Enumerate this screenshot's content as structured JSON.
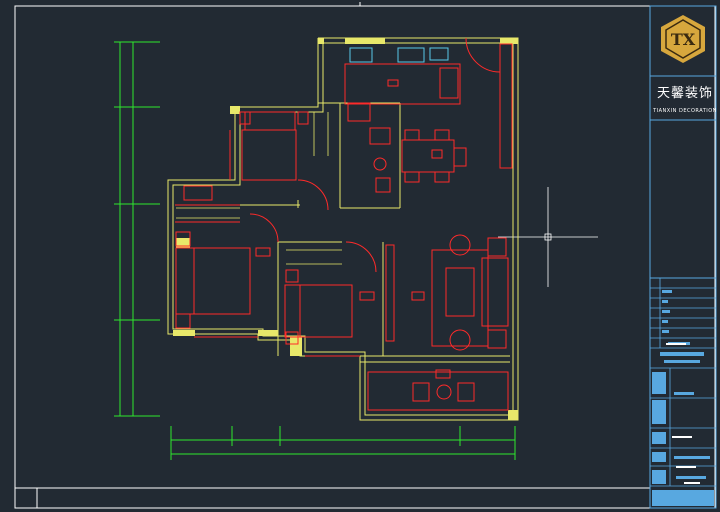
{
  "title_block": {
    "logo_monogram": "TX",
    "company_cn": "天馨装饰",
    "company_en": "TIANXIN DECORATION"
  },
  "colors": {
    "background": "#222a33",
    "wall": "#e8e86a",
    "furniture": "#ff2a2a",
    "dimension": "#2ee82e",
    "frame": "#ffffff",
    "title_block": "#58a8e0",
    "annotation": "#ffffff",
    "logo_gold": "#d7a73d"
  }
}
